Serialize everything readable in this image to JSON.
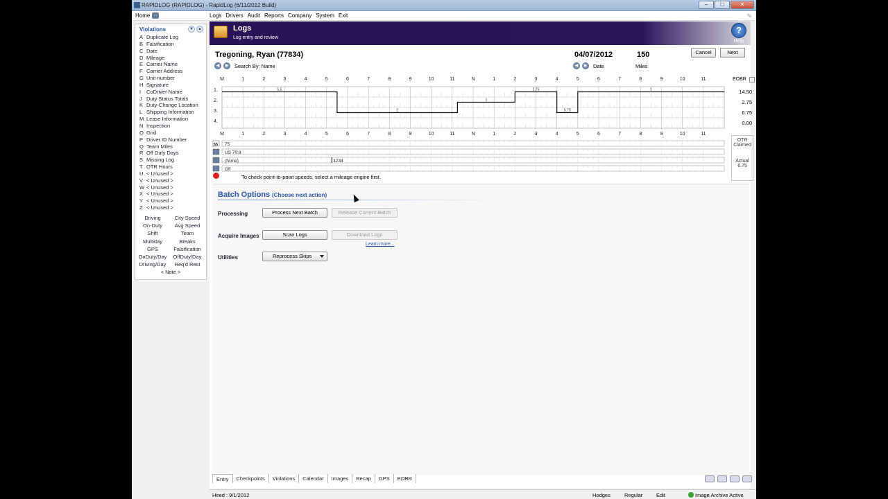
{
  "window": {
    "title": "RAPIDLOG (RAPIDLOG) - RapidLog  (6/11/2012 Build)"
  },
  "menubar": {
    "home": "Home",
    "menus": [
      "Logs",
      "Drivers",
      "Audit",
      "Reports",
      "Company",
      "System",
      "Exit"
    ]
  },
  "sidebar": {
    "title": "Violations",
    "violations": [
      {
        "key": "A",
        "label": "Duplicate Log"
      },
      {
        "key": "B",
        "label": "Falsification"
      },
      {
        "key": "C",
        "label": "Date"
      },
      {
        "key": "D",
        "label": "Mileage"
      },
      {
        "key": "E",
        "label": "Carrier Name"
      },
      {
        "key": "F",
        "label": "Carrier Address"
      },
      {
        "key": "G",
        "label": "Unit number"
      },
      {
        "key": "H",
        "label": "Signature"
      },
      {
        "key": "I",
        "label": "CoDriver Name"
      },
      {
        "key": "J",
        "label": "Duty Status Totals"
      },
      {
        "key": "K",
        "label": "Duty-Change Location"
      },
      {
        "key": "L",
        "label": "Shipping Information"
      },
      {
        "key": "M",
        "label": "Lease Information"
      },
      {
        "key": "N",
        "label": "Inspection"
      },
      {
        "key": "O",
        "label": "Grid"
      },
      {
        "key": "P",
        "label": "Driver ID Number"
      },
      {
        "key": "Q",
        "label": "Team Miles"
      },
      {
        "key": "R",
        "label": "Off Duty Days"
      },
      {
        "key": "S",
        "label": "Missing Log"
      },
      {
        "key": "T",
        "label": "OTR Hours"
      },
      {
        "key": "U",
        "label": "< Unused >"
      },
      {
        "key": "V",
        "label": "< Unused >"
      },
      {
        "key": "W",
        "label": "< Unused >"
      },
      {
        "key": "X",
        "label": "< Unused >"
      },
      {
        "key": "Y",
        "label": "< Unused >"
      },
      {
        "key": "Z",
        "label": "< Unused >"
      }
    ],
    "categories": [
      "Driving",
      "City Speed",
      "On-Duty",
      "Avg Speed",
      "Shift",
      "Team",
      "Multiday",
      "Breaks",
      "GPS",
      "Falsification",
      "OnDuty/Day",
      "OffDuty/Day",
      "Driving/Day",
      "Req'd Rest"
    ],
    "note": "< Note >"
  },
  "banner": {
    "title": "Logs",
    "subtitle": "Log entry and review",
    "help": "Help"
  },
  "log": {
    "driver": "Tregoning, Ryan (77834)",
    "date": "04/07/2012",
    "miles": "150",
    "search_by": "Search By: Name",
    "date_label": "Date",
    "miles_label": "Miles",
    "cancel": "Cancel",
    "next": "Next",
    "eobr": "EOBR",
    "hour_labels": [
      "M",
      "1",
      "2",
      "3",
      "4",
      "5",
      "6",
      "7",
      "8",
      "9",
      "10",
      "11",
      "N",
      "1",
      "2",
      "3",
      "4",
      "5",
      "6",
      "7",
      "8",
      "9",
      "10",
      "11"
    ],
    "row_labels": [
      "1.",
      "2.",
      "3.",
      "4."
    ],
    "totals": [
      "14.50",
      "2.75",
      "6.75",
      "0.00"
    ],
    "segment_labels": [
      "5.5",
      "2",
      "1",
      "2.75",
      "5.75",
      "1"
    ],
    "duty_graph": [
      {
        "row": 1,
        "start": 0,
        "end": 5.5
      },
      {
        "row": 3,
        "start": 5.5,
        "end": 11.25
      },
      {
        "row": 2,
        "start": 11.25,
        "end": 14
      },
      {
        "row": 1,
        "start": 14,
        "end": 16
      },
      {
        "row": 3,
        "start": 16,
        "end": 17
      },
      {
        "row": 1,
        "start": 17,
        "end": 24
      }
    ],
    "strip": {
      "speed_label": "55",
      "speed_value": "75",
      "rule": "US 70:8",
      "trailer": "(None)",
      "trailer_value": "1234",
      "engine": "Off"
    },
    "otr": {
      "claimed_label": "OTR Claimed",
      "actual_label": "Actual",
      "actual_value": "6.75"
    },
    "gps_note": "To check point-to-point speeds, select a mileage engine first."
  },
  "batch": {
    "title": "Batch Options",
    "choose": "(Choose next action)",
    "processing_label": "Processing",
    "process_next": "Process Next Batch",
    "release_current": "Release Current Batch",
    "acquire_label": "Acquire Images",
    "scan_logs": "Scan Logs",
    "download_logs": "Download Logs",
    "learn_more": "Learn more...",
    "utilities_label": "Utilities",
    "reprocess": "Reprocess Skips"
  },
  "tabs": [
    "Entry",
    "Checkpoints",
    "Violations",
    "Calendar",
    "Images",
    "Recap",
    "GPS",
    "EOBR"
  ],
  "status": {
    "hired": "Hired : 9/1/2012",
    "driver": "Hodges",
    "mode": "Regular",
    "edit": "Edit",
    "archive": "Image Archive Active"
  }
}
